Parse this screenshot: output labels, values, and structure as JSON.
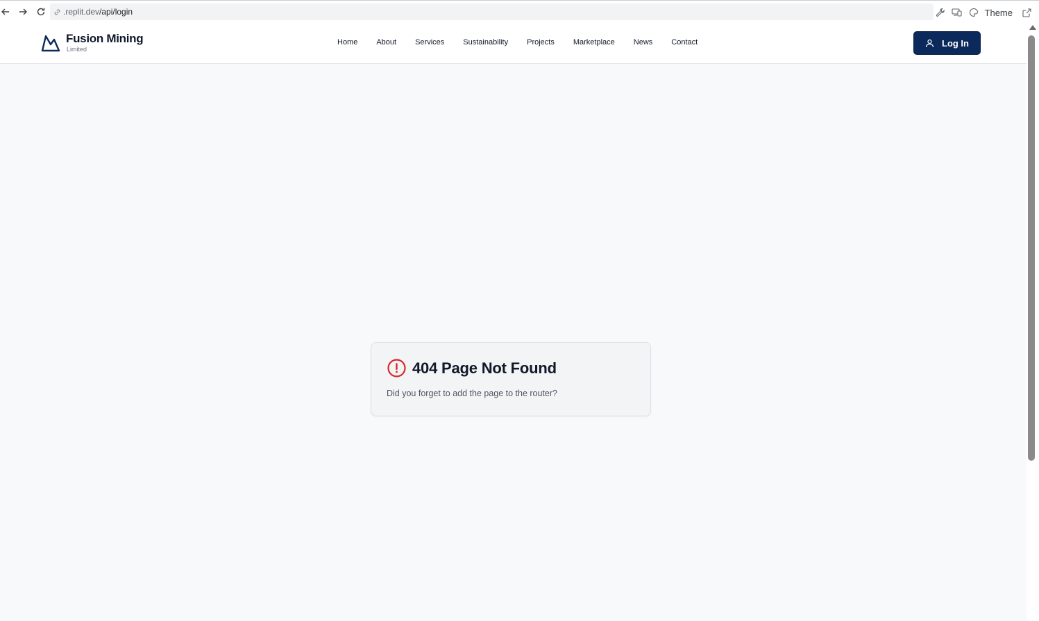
{
  "browser": {
    "url_host": ".replit.dev",
    "url_path": "/api/login",
    "theme_label": "Theme",
    "icons": [
      "back-arrow-icon",
      "forward-arrow-icon",
      "reload-icon",
      "link-icon",
      "wrench-icon",
      "devices-icon",
      "palette-icon",
      "external-link-icon"
    ]
  },
  "header": {
    "brand_name": "Fusion Mining",
    "brand_sub": "Limited",
    "nav": [
      {
        "label": "Home"
      },
      {
        "label": "About"
      },
      {
        "label": "Services"
      },
      {
        "label": "Sustainability"
      },
      {
        "label": "Projects"
      },
      {
        "label": "Marketplace"
      },
      {
        "label": "News"
      },
      {
        "label": "Contact"
      }
    ],
    "login_label": "Log In"
  },
  "error_card": {
    "title": "404 Page Not Found",
    "message": "Did you forget to add the page to the router?"
  },
  "colors": {
    "primary": "#0b2a5b",
    "error": "#dc2626",
    "page_bg": "#f8f9fa"
  }
}
